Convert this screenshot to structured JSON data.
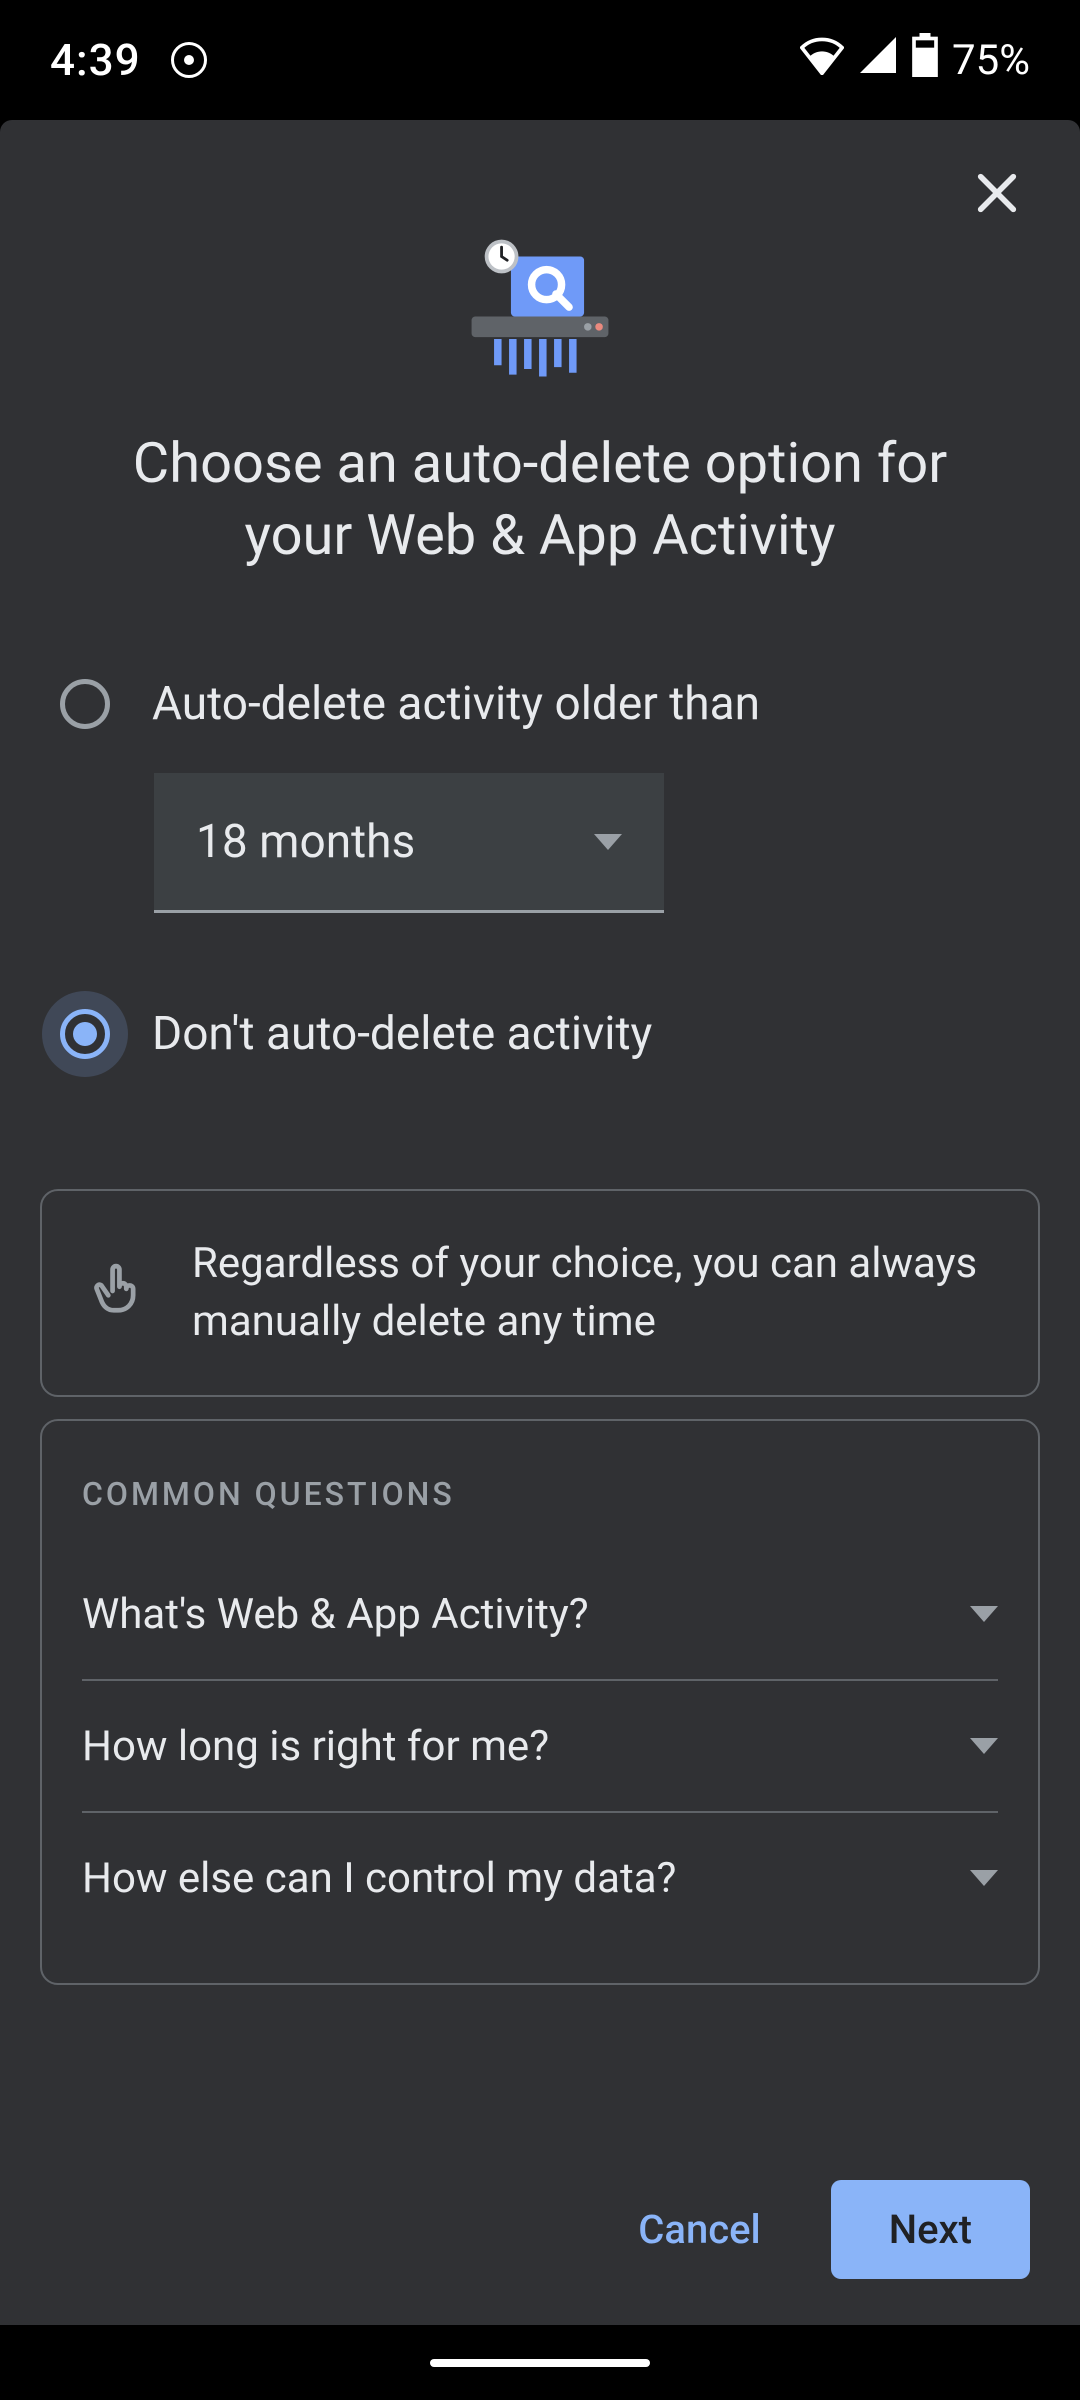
{
  "status": {
    "time": "4:39",
    "battery_pct": "75%"
  },
  "title": "Choose an auto-delete option for your Web & App Activity",
  "option1": {
    "label": "Auto-delete activity older than",
    "dropdown_value": "18 months"
  },
  "option2": {
    "label": "Don't auto-delete activity"
  },
  "info": {
    "text": "Regardless of your choice, you can always manually delete any time"
  },
  "faq": {
    "heading": "COMMON QUESTIONS",
    "items": [
      "What's Web & App Activity?",
      "How long is right for me?",
      "How else can I control my data?"
    ]
  },
  "footer": {
    "cancel": "Cancel",
    "next": "Next"
  }
}
